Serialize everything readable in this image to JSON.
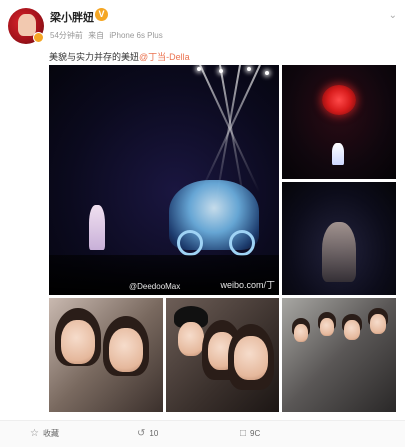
{
  "post": {
    "username": "梁小胖妞",
    "time": "54分钟前",
    "source_prefix": "来自",
    "device": "iPhone 6s Plus",
    "text_prefix": "美貌与实力并存的美妞",
    "mention": "@丁当-Della"
  },
  "watermark": {
    "handle": "@DeedooMax",
    "site": "weibo.com/丁"
  },
  "actions": {
    "collect": "收藏",
    "repost": "10",
    "comment": "9C"
  },
  "icons": {
    "chevron": "chevron-down-icon",
    "verified": "verified-badge-icon",
    "collect": "star-icon",
    "repost": "repost-icon",
    "comment": "comment-icon"
  }
}
